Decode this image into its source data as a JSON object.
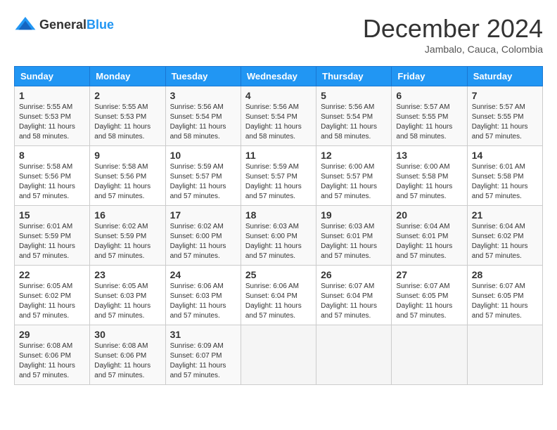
{
  "header": {
    "logo_line1": "General",
    "logo_line2": "Blue",
    "month_title": "December 2024",
    "location": "Jambalo, Cauca, Colombia"
  },
  "days_of_week": [
    "Sunday",
    "Monday",
    "Tuesday",
    "Wednesday",
    "Thursday",
    "Friday",
    "Saturday"
  ],
  "weeks": [
    [
      {
        "day": "1",
        "sunrise": "5:55 AM",
        "sunset": "5:53 PM",
        "daylight": "11 hours and 58 minutes."
      },
      {
        "day": "2",
        "sunrise": "5:55 AM",
        "sunset": "5:53 PM",
        "daylight": "11 hours and 58 minutes."
      },
      {
        "day": "3",
        "sunrise": "5:56 AM",
        "sunset": "5:54 PM",
        "daylight": "11 hours and 58 minutes."
      },
      {
        "day": "4",
        "sunrise": "5:56 AM",
        "sunset": "5:54 PM",
        "daylight": "11 hours and 58 minutes."
      },
      {
        "day": "5",
        "sunrise": "5:56 AM",
        "sunset": "5:54 PM",
        "daylight": "11 hours and 58 minutes."
      },
      {
        "day": "6",
        "sunrise": "5:57 AM",
        "sunset": "5:55 PM",
        "daylight": "11 hours and 58 minutes."
      },
      {
        "day": "7",
        "sunrise": "5:57 AM",
        "sunset": "5:55 PM",
        "daylight": "11 hours and 57 minutes."
      }
    ],
    [
      {
        "day": "8",
        "sunrise": "5:58 AM",
        "sunset": "5:56 PM",
        "daylight": "11 hours and 57 minutes."
      },
      {
        "day": "9",
        "sunrise": "5:58 AM",
        "sunset": "5:56 PM",
        "daylight": "11 hours and 57 minutes."
      },
      {
        "day": "10",
        "sunrise": "5:59 AM",
        "sunset": "5:57 PM",
        "daylight": "11 hours and 57 minutes."
      },
      {
        "day": "11",
        "sunrise": "5:59 AM",
        "sunset": "5:57 PM",
        "daylight": "11 hours and 57 minutes."
      },
      {
        "day": "12",
        "sunrise": "6:00 AM",
        "sunset": "5:57 PM",
        "daylight": "11 hours and 57 minutes."
      },
      {
        "day": "13",
        "sunrise": "6:00 AM",
        "sunset": "5:58 PM",
        "daylight": "11 hours and 57 minutes."
      },
      {
        "day": "14",
        "sunrise": "6:01 AM",
        "sunset": "5:58 PM",
        "daylight": "11 hours and 57 minutes."
      }
    ],
    [
      {
        "day": "15",
        "sunrise": "6:01 AM",
        "sunset": "5:59 PM",
        "daylight": "11 hours and 57 minutes."
      },
      {
        "day": "16",
        "sunrise": "6:02 AM",
        "sunset": "5:59 PM",
        "daylight": "11 hours and 57 minutes."
      },
      {
        "day": "17",
        "sunrise": "6:02 AM",
        "sunset": "6:00 PM",
        "daylight": "11 hours and 57 minutes."
      },
      {
        "day": "18",
        "sunrise": "6:03 AM",
        "sunset": "6:00 PM",
        "daylight": "11 hours and 57 minutes."
      },
      {
        "day": "19",
        "sunrise": "6:03 AM",
        "sunset": "6:01 PM",
        "daylight": "11 hours and 57 minutes."
      },
      {
        "day": "20",
        "sunrise": "6:04 AM",
        "sunset": "6:01 PM",
        "daylight": "11 hours and 57 minutes."
      },
      {
        "day": "21",
        "sunrise": "6:04 AM",
        "sunset": "6:02 PM",
        "daylight": "11 hours and 57 minutes."
      }
    ],
    [
      {
        "day": "22",
        "sunrise": "6:05 AM",
        "sunset": "6:02 PM",
        "daylight": "11 hours and 57 minutes."
      },
      {
        "day": "23",
        "sunrise": "6:05 AM",
        "sunset": "6:03 PM",
        "daylight": "11 hours and 57 minutes."
      },
      {
        "day": "24",
        "sunrise": "6:06 AM",
        "sunset": "6:03 PM",
        "daylight": "11 hours and 57 minutes."
      },
      {
        "day": "25",
        "sunrise": "6:06 AM",
        "sunset": "6:04 PM",
        "daylight": "11 hours and 57 minutes."
      },
      {
        "day": "26",
        "sunrise": "6:07 AM",
        "sunset": "6:04 PM",
        "daylight": "11 hours and 57 minutes."
      },
      {
        "day": "27",
        "sunrise": "6:07 AM",
        "sunset": "6:05 PM",
        "daylight": "11 hours and 57 minutes."
      },
      {
        "day": "28",
        "sunrise": "6:07 AM",
        "sunset": "6:05 PM",
        "daylight": "11 hours and 57 minutes."
      }
    ],
    [
      {
        "day": "29",
        "sunrise": "6:08 AM",
        "sunset": "6:06 PM",
        "daylight": "11 hours and 57 minutes."
      },
      {
        "day": "30",
        "sunrise": "6:08 AM",
        "sunset": "6:06 PM",
        "daylight": "11 hours and 57 minutes."
      },
      {
        "day": "31",
        "sunrise": "6:09 AM",
        "sunset": "6:07 PM",
        "daylight": "11 hours and 57 minutes."
      },
      null,
      null,
      null,
      null
    ]
  ],
  "labels": {
    "sunrise_prefix": "Sunrise: ",
    "sunset_prefix": "Sunset: ",
    "daylight_prefix": "Daylight: "
  }
}
